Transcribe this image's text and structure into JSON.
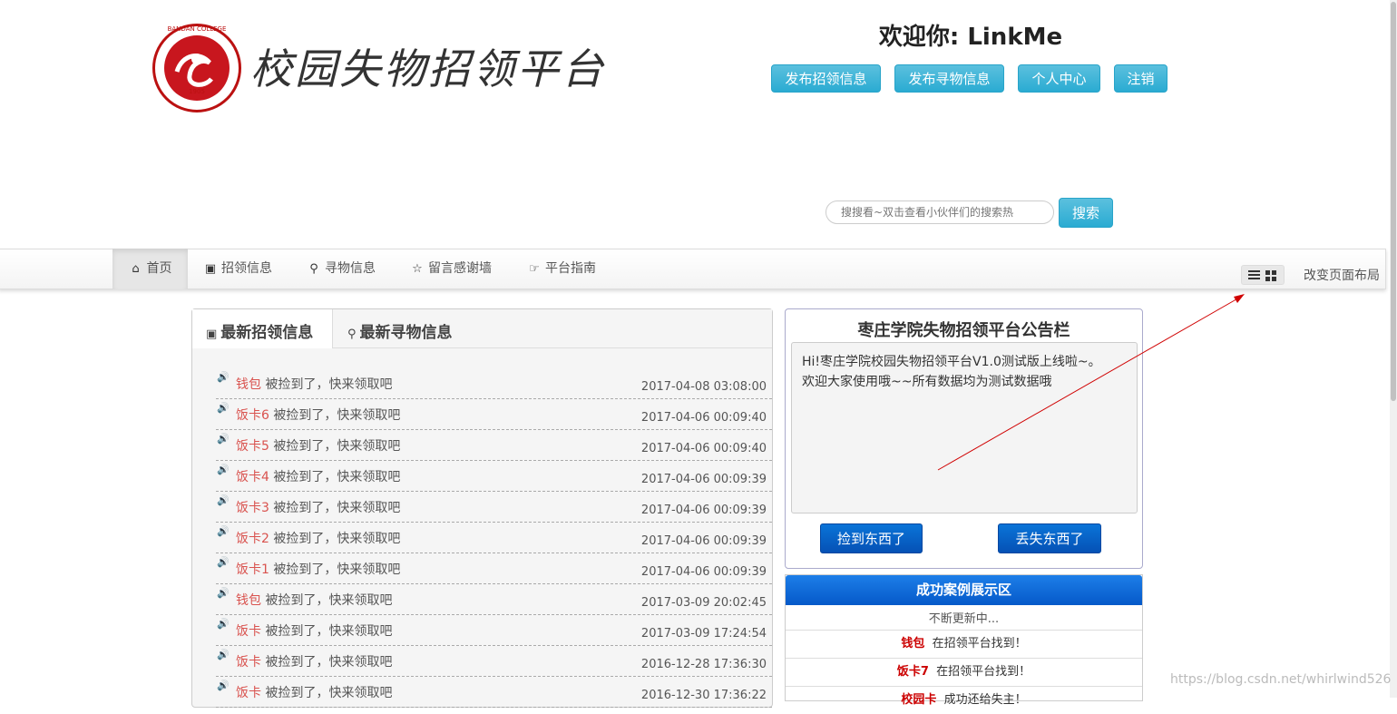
{
  "header": {
    "logo_text": "BANDAN COLLEGE",
    "logo_year": "1905",
    "site_title": "校园失物招领平台",
    "welcome": "欢迎你: LinkMe",
    "buttons": [
      "发布招领信息",
      "发布寻物信息",
      "个人中心",
      "注销"
    ]
  },
  "search": {
    "placeholder": "搜搜看~双击查看小伙伴们的搜索热",
    "button": "搜索"
  },
  "nav": {
    "items": [
      {
        "label": "首页",
        "icon": "home-icon"
      },
      {
        "label": "招领信息",
        "icon": "picture-icon"
      },
      {
        "label": "寻物信息",
        "icon": "zoom-icon"
      },
      {
        "label": "留言感谢墙",
        "icon": "star-icon"
      },
      {
        "label": "平台指南",
        "icon": "hand-right-icon"
      }
    ],
    "layout_label": "改变页面布局"
  },
  "tabs": [
    "最新招领信息",
    "最新寻物信息"
  ],
  "feed": [
    {
      "name": "钱包",
      "text": "被捡到了，快来领取吧",
      "time": "2017-04-08 03:08:00"
    },
    {
      "name": "饭卡6",
      "text": "被捡到了，快来领取吧",
      "time": "2017-04-06 00:09:40"
    },
    {
      "name": "饭卡5",
      "text": "被捡到了，快来领取吧",
      "time": "2017-04-06 00:09:40"
    },
    {
      "name": "饭卡4",
      "text": "被捡到了，快来领取吧",
      "time": "2017-04-06 00:09:39"
    },
    {
      "name": "饭卡3",
      "text": "被捡到了，快来领取吧",
      "time": "2017-04-06 00:09:39"
    },
    {
      "name": "饭卡2",
      "text": "被捡到了，快来领取吧",
      "time": "2017-04-06 00:09:39"
    },
    {
      "name": "饭卡1",
      "text": "被捡到了，快来领取吧",
      "time": "2017-04-06 00:09:39"
    },
    {
      "name": "钱包",
      "text": "被捡到了，快来领取吧",
      "time": "2017-03-09 20:02:45"
    },
    {
      "name": "饭卡",
      "text": "被捡到了，快来领取吧",
      "time": "2017-03-09 17:24:54"
    },
    {
      "name": "饭卡",
      "text": "被捡到了，快来领取吧",
      "time": "2016-12-28 17:36:30"
    },
    {
      "name": "饭卡",
      "text": "被捡到了，快来领取吧",
      "time": "2016-12-30 17:36:22"
    }
  ],
  "notice": {
    "title": "枣庄学院失物招领平台公告栏",
    "line1": "Hi!枣庄学院校园失物招领平台V1.0测试版上线啦~。",
    "line2": "欢迎大家使用哦~~所有数据均为测试数据哦",
    "found_button": "捡到东西了",
    "lost_button": "丢失东西了"
  },
  "cases": {
    "title": "成功案例展示区",
    "subtitle": "不断更新中...",
    "items": [
      {
        "name": "钱包",
        "text": "在招领平台找到！"
      },
      {
        "name": "饭卡7",
        "text": "在招领平台找到！"
      },
      {
        "name": "校园卡",
        "text": "成功还给失主！"
      }
    ]
  },
  "watermark": "https://blog.csdn.net/whirlwind526",
  "colors": {
    "accent": "#2aabd2",
    "primary": "#0551b5",
    "item_name": "#d9534f",
    "annotation_arrow": "#d00000"
  }
}
